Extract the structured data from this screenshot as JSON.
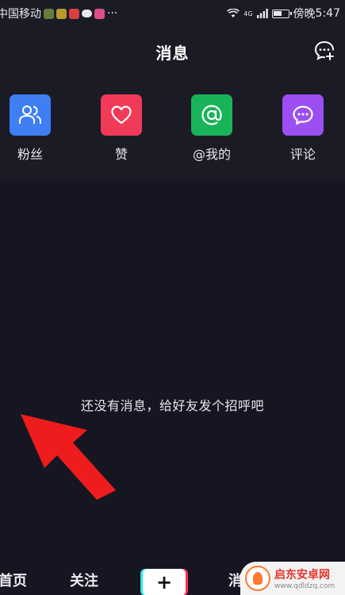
{
  "status_bar": {
    "carrier": "中国移动",
    "more": "···",
    "network": "4G",
    "charging_label": "傍晚",
    "time": "5:47",
    "battery_level": 0.6
  },
  "header": {
    "title": "消息",
    "action_icon": "chat-plus-icon"
  },
  "categories": [
    {
      "label": "粉丝",
      "icon": "fans-icon",
      "color": "#3f7ef3"
    },
    {
      "label": "赞",
      "icon": "heart-icon",
      "color": "#f03a58"
    },
    {
      "label": "@我的",
      "icon": "at-icon",
      "color": "#19b35a"
    },
    {
      "label": "评论",
      "icon": "comment-icon",
      "color": "#9b4ff2"
    }
  ],
  "empty_state": {
    "message": "还没有消息，给好友发个招呼吧"
  },
  "tabbar": {
    "home": "首页",
    "follow": "关注",
    "add_icon": "plus-icon",
    "messages": "消"
  },
  "watermark": {
    "title": "启东安卓网",
    "url": "www.qdldzq.com"
  }
}
